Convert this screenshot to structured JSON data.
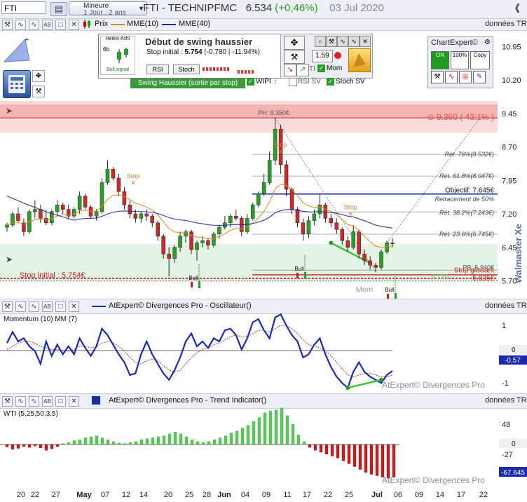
{
  "top": {
    "ticker_input": "FTI",
    "timeframe_line1": "Mineure",
    "timeframe_line2": "1 Jour , 2 ans",
    "title_name": "FTI - TECHNIPFMC",
    "title_price": "6.534",
    "title_change": "(+0,46%)",
    "title_date": "03 Jul 2020"
  },
  "main_toolbar": {
    "prix_label": "Prix",
    "mme10_label": "MME(10)",
    "mme40_label": "MME(40)",
    "donnees_label": "données TR"
  },
  "swing_panel": {
    "heikin_label": "Heikin Ashi",
    "period_label": "6b",
    "bull_signal_label": "Bull signal",
    "title": "Début de swing haussier",
    "stop_label": "Stop initial :",
    "stop_value": "5.754",
    "stop_change": "(-0.780 | -11.94%)",
    "rsi_button": "RSI",
    "stoch_button": "Stoch",
    "value_1_59": "1.59",
    "mom_label": "Mom",
    "wipi_label": "WIPI",
    "rsi_sv_label": "RSI SV",
    "stoch_sv_label": "Stoch SV",
    "banner": "Swing Haussier (sortie par stop)",
    "ti_label": "TI"
  },
  "chartexpert": {
    "title": "ChartExpert©",
    "on_label": "ON",
    "pct_label": "100%",
    "copy_label": "Copy"
  },
  "watermark": "Walmaster Xe",
  "chart_data": [
    {
      "type": "candlestick",
      "pane": "price",
      "ylim": [
        5.3,
        11.3
      ],
      "y_ticks": [
        "10.95",
        "10.20",
        "9.45",
        "8.70",
        "7.95",
        "7.20",
        "6.45",
        "5.70"
      ],
      "series": [
        {
          "name": "Prix",
          "ohlc": [
            [
              6.9,
              7.0,
              6.8,
              6.95
            ],
            [
              6.95,
              7.25,
              6.9,
              7.2
            ],
            [
              7.2,
              7.35,
              7.0,
              7.05
            ],
            [
              7.0,
              7.1,
              6.7,
              6.8
            ],
            [
              6.8,
              7.3,
              6.75,
              7.25
            ],
            [
              7.25,
              7.5,
              7.1,
              7.3
            ],
            [
              7.3,
              7.4,
              7.0,
              7.1
            ],
            [
              7.1,
              7.3,
              6.95,
              7.0
            ],
            [
              7.0,
              7.3,
              6.95,
              7.25
            ],
            [
              7.25,
              7.5,
              7.15,
              7.4
            ],
            [
              7.4,
              7.45,
              7.2,
              7.3
            ],
            [
              7.3,
              7.4,
              7.1,
              7.15
            ],
            [
              7.15,
              7.35,
              7.1,
              7.3
            ],
            [
              7.3,
              7.7,
              7.2,
              7.6
            ],
            [
              7.6,
              7.65,
              7.3,
              7.35
            ],
            [
              7.35,
              7.4,
              7.1,
              7.15
            ],
            [
              7.15,
              7.3,
              7.05,
              7.25
            ],
            [
              7.25,
              8.0,
              7.2,
              7.9
            ],
            [
              7.9,
              8.4,
              7.85,
              8.2
            ],
            [
              8.2,
              8.25,
              7.95,
              8.0
            ],
            [
              8.0,
              8.1,
              7.6,
              7.7
            ],
            [
              7.7,
              7.8,
              7.3,
              7.4
            ],
            [
              7.4,
              7.5,
              7.1,
              7.2
            ],
            [
              7.2,
              7.3,
              7.0,
              7.1
            ],
            [
              7.1,
              7.25,
              7.0,
              7.2
            ],
            [
              7.2,
              7.3,
              7.05,
              7.15
            ],
            [
              7.15,
              7.2,
              6.9,
              7.0
            ],
            [
              7.0,
              7.05,
              6.6,
              6.7
            ],
            [
              6.7,
              6.75,
              6.2,
              6.3
            ],
            [
              6.3,
              6.45,
              5.8,
              6.2
            ],
            [
              6.2,
              6.5,
              6.1,
              6.45
            ],
            [
              6.45,
              6.8,
              6.35,
              6.7
            ],
            [
              6.7,
              6.85,
              6.55,
              6.8
            ],
            [
              6.8,
              6.85,
              6.3,
              6.4
            ],
            [
              6.4,
              6.6,
              6.15,
              6.55
            ],
            [
              6.55,
              6.7,
              6.45,
              6.6
            ],
            [
              6.6,
              6.65,
              6.4,
              6.5
            ],
            [
              6.5,
              6.8,
              6.45,
              6.75
            ],
            [
              6.75,
              6.95,
              6.65,
              6.9
            ],
            [
              6.9,
              7.15,
              6.85,
              7.0
            ],
            [
              7.0,
              7.2,
              6.9,
              7.15
            ],
            [
              7.15,
              7.3,
              7.05,
              7.1
            ],
            [
              7.1,
              7.15,
              6.7,
              6.8
            ],
            [
              6.8,
              7.2,
              6.75,
              7.1
            ],
            [
              7.1,
              7.45,
              7.05,
              7.4
            ],
            [
              7.4,
              7.7,
              7.35,
              7.65
            ],
            [
              7.65,
              8.1,
              7.6,
              7.9
            ],
            [
              7.9,
              8.6,
              7.85,
              8.4
            ],
            [
              8.4,
              9.35,
              8.3,
              9.1
            ],
            [
              9.1,
              9.2,
              8.1,
              8.3
            ],
            [
              8.3,
              8.4,
              7.6,
              7.75
            ],
            [
              7.75,
              7.8,
              7.2,
              7.3
            ],
            [
              7.3,
              7.35,
              6.9,
              7.0
            ],
            [
              7.0,
              7.1,
              6.6,
              6.75
            ],
            [
              6.75,
              7.15,
              6.65,
              7.05
            ],
            [
              7.05,
              7.3,
              6.95,
              7.2
            ],
            [
              7.2,
              7.65,
              7.1,
              7.4
            ],
            [
              7.4,
              7.45,
              7.0,
              7.1
            ],
            [
              7.1,
              7.2,
              6.9,
              7.0
            ],
            [
              7.0,
              7.1,
              6.75,
              6.85
            ],
            [
              6.85,
              6.9,
              6.5,
              6.6
            ],
            [
              6.6,
              6.7,
              6.35,
              6.45
            ],
            [
              6.45,
              6.95,
              6.4,
              6.8
            ],
            [
              6.8,
              6.85,
              6.2,
              6.3
            ],
            [
              6.3,
              6.4,
              6.05,
              6.15
            ],
            [
              6.15,
              6.25,
              5.95,
              6.05
            ],
            [
              6.05,
              6.1,
              5.9,
              6.0
            ],
            [
              6.0,
              6.4,
              5.95,
              6.35
            ],
            [
              6.35,
              6.6,
              6.3,
              6.55
            ],
            [
              6.55,
              6.65,
              6.45,
              6.53
            ]
          ]
        },
        {
          "name": "MME(10)"
        },
        {
          "name": "MME(40)"
        }
      ],
      "annotations": [
        {
          "text": "PH: 9.350€",
          "y": 9.35
        },
        {
          "text": "⊙ 9.350 ( 43.1% )",
          "y": 9.35
        },
        {
          "text": "Rét. 76%(8.532€)",
          "y": 8.532
        },
        {
          "text": "Rét. 61.8%(8.047€)",
          "y": 8.047
        },
        {
          "text": "Objectif: 7.645€",
          "y": 7.645
        },
        {
          "text": "Retracement de 50%",
          "y": 7.55
        },
        {
          "text": "Rét. 38.2%(7.243€)",
          "y": 7.243
        },
        {
          "text": "Rét. 23.6%(6.745€)",
          "y": 6.745
        },
        {
          "text": "PB: 5.940€",
          "y": 5.94
        },
        {
          "text": "Stop glissant",
          "y": 5.87
        },
        {
          "text": "5.835€",
          "y": 5.835
        },
        {
          "text": "5.770",
          "y": 5.77
        },
        {
          "text": "Stop initial : 5.754€",
          "y": 5.754
        }
      ],
      "markers": [
        "Stop",
        "Stop",
        "Stop",
        "Bull",
        "Bull",
        "Bull",
        "Mom"
      ]
    },
    {
      "type": "line",
      "pane": "oscillator",
      "title": "AtExpert© Divergences Pro - Oscillateur()",
      "label": "Momentum (10) MM (7)",
      "y_ticks": [
        "1",
        "0",
        "-1"
      ],
      "current_value": "-0.57",
      "watermark": "AtExpert© Divergences Pro",
      "ylim": [
        -1.25,
        1.25
      ],
      "series": [
        {
          "name": "Momentum (10)",
          "values": [
            0.3,
            0.65,
            0.35,
            0.45,
            0.2,
            0.05,
            -0.35,
            0.35,
            -0.1,
            0.25,
            -0.05,
            0.2,
            -0.05,
            0.45,
            0.15,
            -0.1,
            0.2,
            0.75,
            0.55,
            0.25,
            -0.05,
            -0.3,
            -0.7,
            -0.65,
            -0.05,
            0.35,
            -0.05,
            -0.35,
            -0.65,
            -0.85,
            -0.55,
            -0.15,
            0.35,
            0.6,
            0.2,
            0.35,
            0.15,
            0.45,
            0.35,
            0.7,
            0.75,
            0.55,
            0.1,
            0.45,
            0.95,
            1.05,
            0.7,
            0.45,
            1.1,
            1.2,
            0.85,
            0.55,
            0.35,
            -0.15,
            -0.05,
            0.25,
            0.45,
            -0.05,
            -0.45,
            -0.75,
            -0.95,
            -1.1,
            -0.6,
            -0.3,
            -0.6,
            -0.75,
            -0.85,
            -0.95,
            -0.7,
            -0.57
          ]
        },
        {
          "name": "MM (7)",
          "values": [
            0.1,
            0.2,
            0.3,
            0.35,
            0.35,
            0.3,
            0.2,
            0.15,
            0.1,
            0.1,
            0.05,
            0.05,
            0.1,
            0.2,
            0.2,
            0.15,
            0.2,
            0.3,
            0.35,
            0.3,
            0.2,
            0.05,
            -0.15,
            -0.3,
            -0.35,
            -0.25,
            -0.2,
            -0.25,
            -0.4,
            -0.55,
            -0.6,
            -0.55,
            -0.35,
            -0.15,
            0.0,
            0.1,
            0.15,
            0.25,
            0.3,
            0.4,
            0.5,
            0.55,
            0.5,
            0.5,
            0.6,
            0.7,
            0.7,
            0.65,
            0.75,
            0.85,
            0.85,
            0.75,
            0.6,
            0.4,
            0.25,
            0.2,
            0.15,
            0.05,
            -0.1,
            -0.3,
            -0.5,
            -0.7,
            -0.75,
            -0.7,
            -0.65,
            -0.65,
            -0.7,
            -0.75,
            -0.75,
            -0.7
          ]
        }
      ]
    },
    {
      "type": "bar",
      "pane": "trend",
      "title": "AtExpert© Divergences Pro - Trend Indicator()",
      "label": "WTI (5,25,50,3,5)",
      "y_ticks": [
        "48",
        "0",
        "-27"
      ],
      "current_value": "-67.645",
      "watermark": "AtExpert© Divergences Pro",
      "ylim": [
        -80,
        80
      ],
      "values": [
        -5,
        -10,
        -8,
        -4,
        -6,
        -3,
        -7,
        -12,
        -9,
        -4,
        2,
        4,
        8,
        10,
        14,
        16,
        18,
        14,
        10,
        6,
        3,
        2,
        4,
        6,
        10,
        12,
        14,
        16,
        18,
        22,
        26,
        22,
        16,
        10,
        6,
        4,
        6,
        10,
        14,
        18,
        24,
        28,
        34,
        40,
        48,
        56,
        66,
        70,
        72,
        76,
        60,
        42,
        20,
        6,
        -6,
        -12,
        -16,
        -20,
        -24,
        -28,
        -34,
        -40,
        -46,
        -52,
        -58,
        -62,
        -65,
        -68,
        -70,
        -67.645
      ]
    }
  ],
  "x_axis": {
    "labels": [
      "20",
      "22",
      "27",
      "May",
      "07",
      "12",
      "14",
      "20",
      "25",
      "28",
      "Jun",
      "04",
      "09",
      "11",
      "17",
      "22",
      "25",
      "Jul",
      "06",
      "09",
      "14",
      "17",
      "22"
    ]
  }
}
